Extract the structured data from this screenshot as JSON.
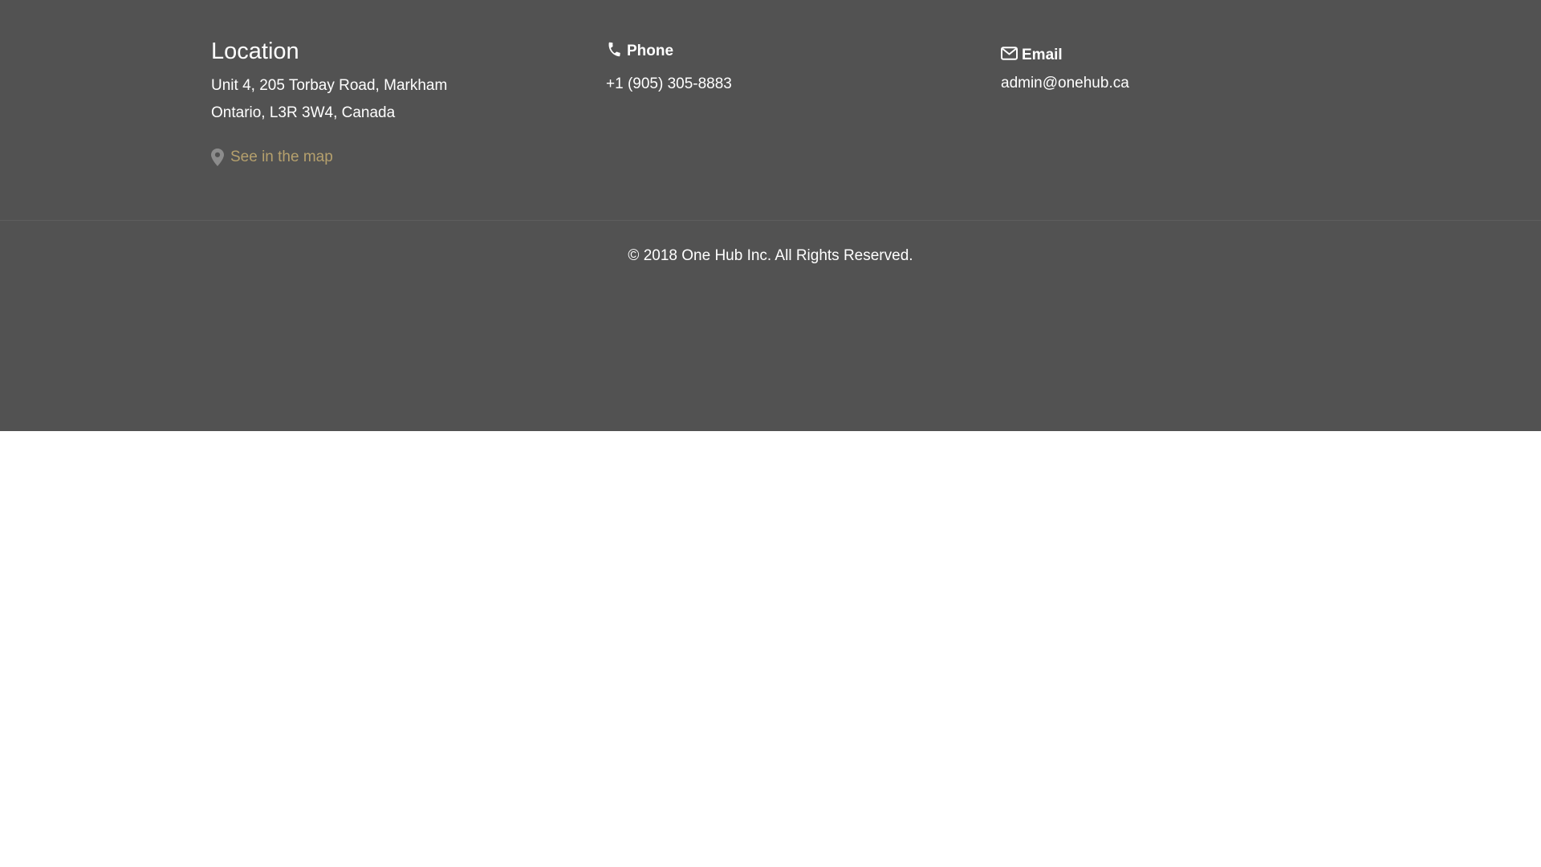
{
  "location": {
    "title": "Location",
    "address_line1": "Unit 4, 205 Torbay Road, Markham",
    "address_line2": "Ontario, L3R 3W4, Canada",
    "map_link_label": "See in the map",
    "map_link_icon": "map-marker-icon"
  },
  "phone": {
    "title": "Phone",
    "icon": "phone-icon",
    "number": "+1 (905) 305-8883"
  },
  "email": {
    "title": "Email",
    "icon": "envelope-icon",
    "address": "admin@onehub.ca"
  },
  "copyright": "© 2018 One Hub Inc. All Rights Reserved.",
  "colors": {
    "footer_background": "#525252",
    "text": "#ffffff",
    "link": "#b5a06d",
    "icon_muted": "#8c8c8c",
    "page_background": "#ffffff"
  }
}
